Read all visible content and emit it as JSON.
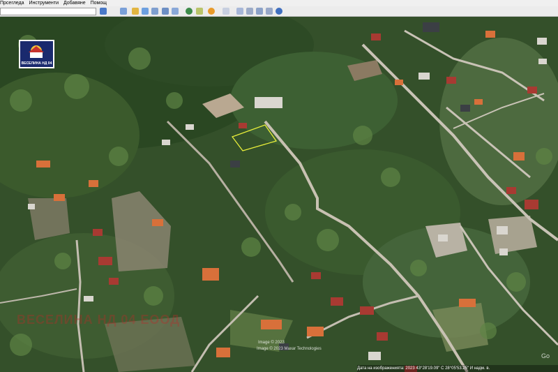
{
  "menu": {
    "items": [
      "Прсегледа",
      "Инструменти",
      "Добавяне",
      "Помощ"
    ]
  },
  "toolbar": {
    "search_value": "",
    "buttons": [
      "search-icon",
      "sidebar-icon",
      "placemark-icon",
      "polygon-icon",
      "path-icon",
      "overlay-icon",
      "tour-icon",
      "sky-icon",
      "history-icon",
      "sun-icon",
      "ruler-icon",
      "email-icon",
      "print-icon",
      "save-image-icon",
      "maps-icon"
    ]
  },
  "logo": {
    "text": "ВЕСЕЛИНА НД 04"
  },
  "watermark": {
    "text": "ВЕСЕЛИНА НД 04 ЕООД"
  },
  "imagery": {
    "line1": "Image © 2023",
    "line2": "Image © 2023 Maxar Technologies"
  },
  "status": {
    "text": "Дата на изображенията: 2023   43°28'19.09\" С   28°05'53.25\" И   надм. в."
  },
  "google": {
    "text": "Go"
  },
  "colors": {
    "boundary": "#e8ee3a",
    "watermark": "#be2828",
    "logo_bg": "#1a2a6e"
  }
}
